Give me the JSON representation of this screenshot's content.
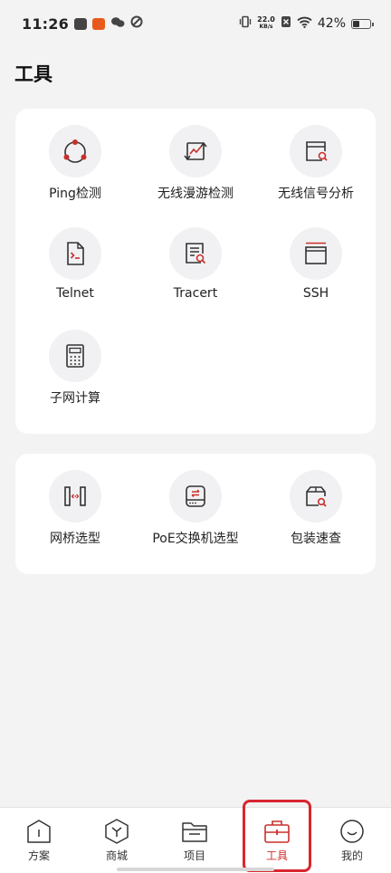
{
  "status_bar": {
    "time": "11:26",
    "net_speed_value": "22.0",
    "net_speed_unit": "KB/s",
    "battery": "42%"
  },
  "page": {
    "title": "工具"
  },
  "tools_primary": [
    {
      "label": "Ping检测",
      "icon": "ping-icon"
    },
    {
      "label": "无线漫游检测",
      "icon": "roaming-icon"
    },
    {
      "label": "无线信号分析",
      "icon": "signal-analysis-icon"
    },
    {
      "label": "Telnet",
      "icon": "terminal-icon"
    },
    {
      "label": "Tracert",
      "icon": "tracert-icon"
    },
    {
      "label": "SSH",
      "icon": "ssh-icon"
    },
    {
      "label": "子网计算",
      "icon": "calculator-icon"
    }
  ],
  "tools_secondary": [
    {
      "label": "网桥选型",
      "icon": "bridge-icon"
    },
    {
      "label": "PoE交换机选型",
      "icon": "switch-icon"
    },
    {
      "label": "包装速查",
      "icon": "package-search-icon"
    }
  ],
  "bottom_nav": [
    {
      "label": "方案",
      "icon": "house-icon"
    },
    {
      "label": "商城",
      "icon": "cube-icon"
    },
    {
      "label": "项目",
      "icon": "folder-icon"
    },
    {
      "label": "工具",
      "icon": "toolbox-icon",
      "active": true
    },
    {
      "label": "我的",
      "icon": "smile-icon"
    }
  ],
  "colors": {
    "accent": "#c9302c",
    "icon_dark": "#333333",
    "background": "#f3f3f3"
  }
}
